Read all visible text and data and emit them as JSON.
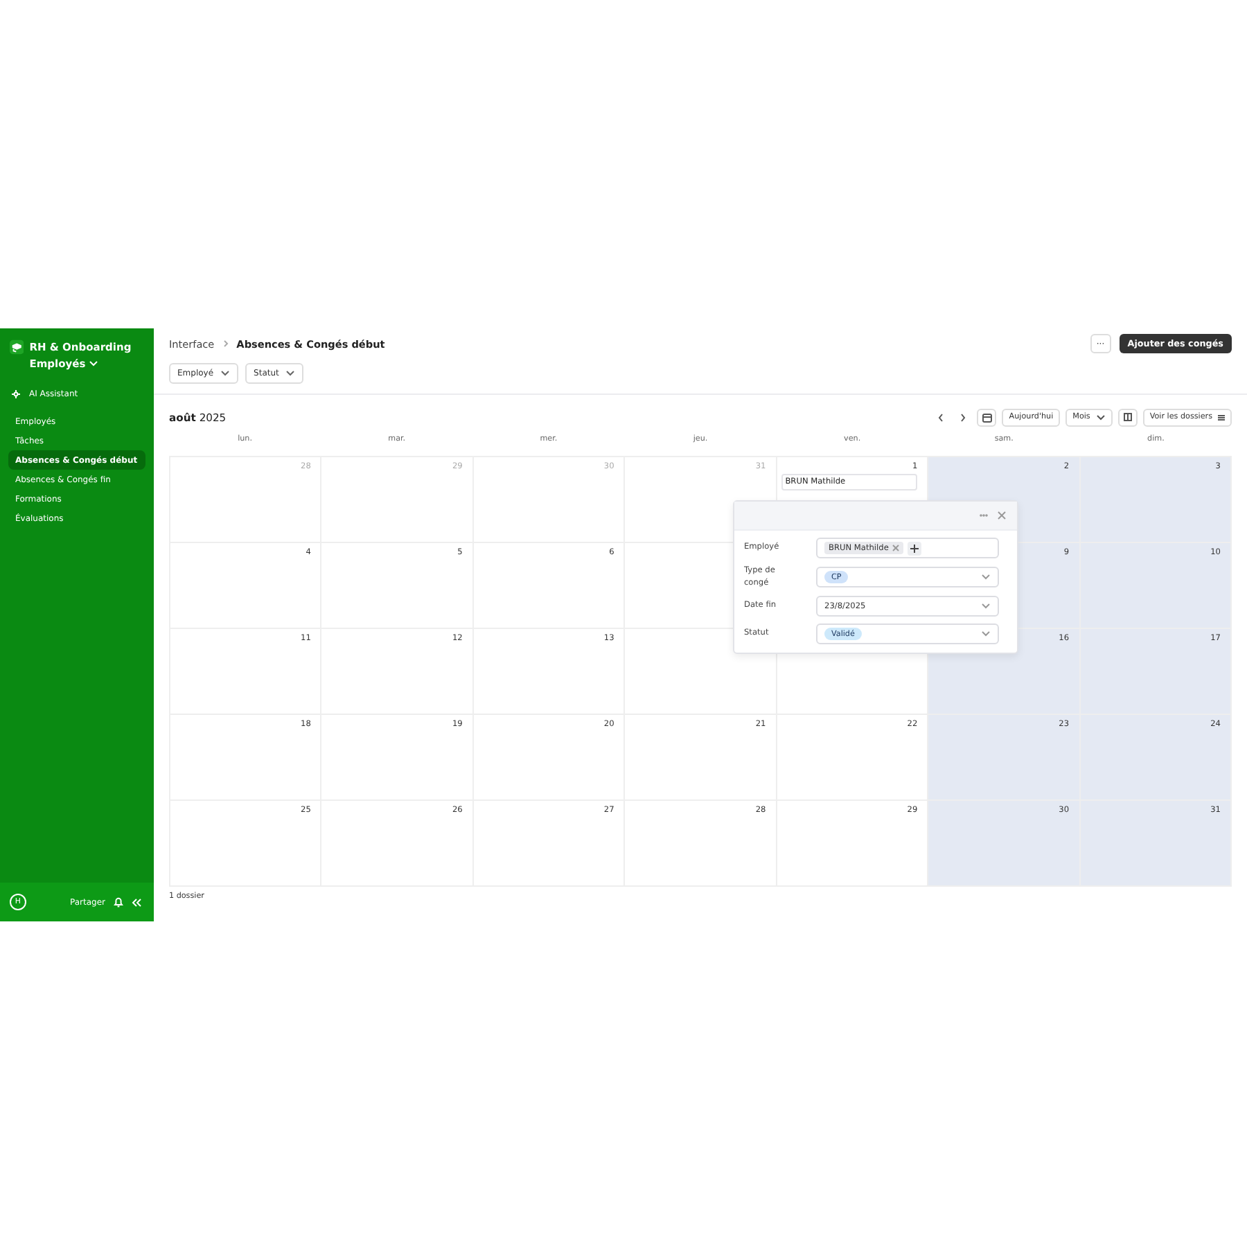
{
  "sidebar": {
    "app_name": "RH & Onboarding Employés",
    "assistant": "AI Assistant",
    "items": [
      {
        "label": "Employés",
        "selected": false
      },
      {
        "label": "Tâches",
        "selected": false
      },
      {
        "label": "Absences & Congés début",
        "selected": true
      },
      {
        "label": "Absences & Congés fin",
        "selected": false
      },
      {
        "label": "Formations",
        "selected": false
      },
      {
        "label": "Évaluations",
        "selected": false
      }
    ],
    "footer": {
      "avatar": "H",
      "share": "Partager"
    }
  },
  "header": {
    "breadcrumb": [
      "Interface",
      "Absences & Congés début"
    ],
    "more": "···",
    "add_button": "Ajouter des congés",
    "filters": [
      "Employé",
      "Statut"
    ]
  },
  "calendar": {
    "month": "août",
    "year": "2025",
    "today_button": "Aujourd'hui",
    "view": "Mois",
    "records_button": "Voir les dossiers",
    "weekdays": [
      {
        "label": "lun.",
        "weekend": false
      },
      {
        "label": "mar.",
        "weekend": false
      },
      {
        "label": "mer.",
        "weekend": false
      },
      {
        "label": "jeu.",
        "weekend": false
      },
      {
        "label": "ven.",
        "weekend": false
      },
      {
        "label": "sam.",
        "weekend": true
      },
      {
        "label": "dim.",
        "weekend": true
      }
    ],
    "weeks": [
      [
        {
          "day": "28",
          "outside": true
        },
        {
          "day": "29",
          "outside": true
        },
        {
          "day": "30",
          "outside": true
        },
        {
          "day": "31",
          "outside": true
        },
        {
          "day": "1",
          "outside": false,
          "events": [
            "BRUN Mathilde"
          ]
        },
        {
          "day": "2",
          "outside": false
        },
        {
          "day": "3",
          "outside": false
        }
      ],
      [
        {
          "day": "4",
          "outside": false
        },
        {
          "day": "5",
          "outside": false
        },
        {
          "day": "6",
          "outside": false
        },
        {
          "day": "9",
          "outside": false
        },
        {
          "day": "10",
          "outside": false
        }
      ],
      [
        {
          "day": "11",
          "outside": false
        },
        {
          "day": "12",
          "outside": false
        },
        {
          "day": "13",
          "outside": false
        },
        {
          "day": "16",
          "outside": false
        },
        {
          "day": "17",
          "outside": false
        }
      ],
      [
        {
          "day": "18",
          "outside": false
        },
        {
          "day": "19",
          "outside": false
        },
        {
          "day": "20",
          "outside": false
        },
        {
          "day": "21",
          "outside": false
        },
        {
          "day": "22",
          "outside": false
        },
        {
          "day": "23",
          "outside": false
        },
        {
          "day": "24",
          "outside": false
        }
      ],
      [
        {
          "day": "25",
          "outside": false
        },
        {
          "day": "26",
          "outside": false
        },
        {
          "day": "27",
          "outside": false
        },
        {
          "day": "28",
          "outside": false
        },
        {
          "day": "29",
          "outside": false
        },
        {
          "day": "30",
          "outside": false
        },
        {
          "day": "31",
          "outside": false
        }
      ]
    ],
    "count": "1 dossier"
  },
  "popup": {
    "fields": [
      {
        "kind": "chips",
        "label": "Employé",
        "value": "BRUN Mathilde"
      },
      {
        "kind": "tag",
        "label": "Type de congé",
        "value": "CP",
        "color": "#cfe2fa"
      },
      {
        "kind": "text",
        "label": "Date fin",
        "value": "23/8/2025"
      },
      {
        "kind": "tag",
        "label": "Statut",
        "value": "Validé",
        "color": "#cde9fb"
      }
    ]
  }
}
